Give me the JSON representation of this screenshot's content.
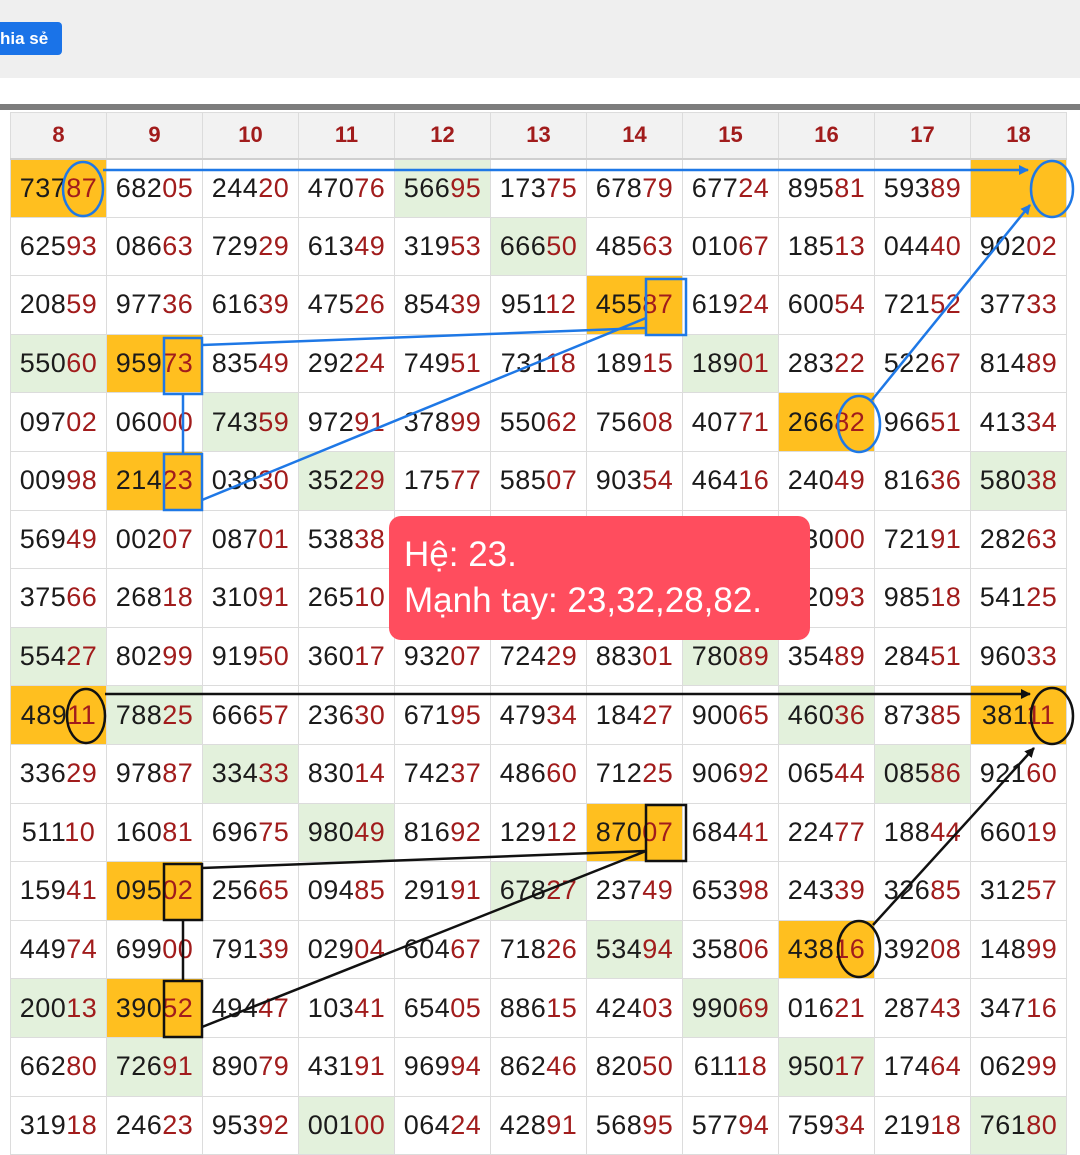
{
  "header": {
    "share_label": "hia sẻ"
  },
  "columns": [
    "8",
    "9",
    "10",
    "11",
    "12",
    "13",
    "14",
    "15",
    "16",
    "17",
    "18"
  ],
  "rows": [
    [
      {
        "h": "737",
        "t": "87",
        "s": "o"
      },
      {
        "h": "682",
        "t": "05"
      },
      {
        "h": "244",
        "t": "20"
      },
      {
        "h": "470",
        "t": "76"
      },
      {
        "h": "566",
        "t": "95",
        "s": "g"
      },
      {
        "h": "173",
        "t": "75"
      },
      {
        "h": "678",
        "t": "79"
      },
      {
        "h": "677",
        "t": "24"
      },
      {
        "h": "895",
        "t": "81"
      },
      {
        "h": "593",
        "t": "89"
      },
      {
        "h": "",
        "t": "",
        "s": "o"
      }
    ],
    [
      {
        "h": "625",
        "t": "93"
      },
      {
        "h": "086",
        "t": "63"
      },
      {
        "h": "729",
        "t": "29"
      },
      {
        "h": "613",
        "t": "49"
      },
      {
        "h": "319",
        "t": "53"
      },
      {
        "h": "666",
        "t": "50",
        "s": "g"
      },
      {
        "h": "485",
        "t": "63"
      },
      {
        "h": "010",
        "t": "67"
      },
      {
        "h": "185",
        "t": "13"
      },
      {
        "h": "044",
        "t": "40"
      },
      {
        "h": "902",
        "t": "02"
      }
    ],
    [
      {
        "h": "208",
        "t": "59"
      },
      {
        "h": "977",
        "t": "36"
      },
      {
        "h": "616",
        "t": "39"
      },
      {
        "h": "475",
        "t": "26"
      },
      {
        "h": "854",
        "t": "39"
      },
      {
        "h": "951",
        "t": "12"
      },
      {
        "h": "455",
        "t": "87",
        "s": "o"
      },
      {
        "h": "619",
        "t": "24"
      },
      {
        "h": "600",
        "t": "54"
      },
      {
        "h": "721",
        "t": "52"
      },
      {
        "h": "377",
        "t": "33"
      }
    ],
    [
      {
        "h": "550",
        "t": "60",
        "s": "g"
      },
      {
        "h": "959",
        "t": "73",
        "s": "o"
      },
      {
        "h": "835",
        "t": "49"
      },
      {
        "h": "292",
        "t": "24"
      },
      {
        "h": "749",
        "t": "51"
      },
      {
        "h": "731",
        "t": "18"
      },
      {
        "h": "189",
        "t": "15"
      },
      {
        "h": "189",
        "t": "01",
        "s": "g"
      },
      {
        "h": "283",
        "t": "22"
      },
      {
        "h": "522",
        "t": "67"
      },
      {
        "h": "814",
        "t": "89"
      }
    ],
    [
      {
        "h": "097",
        "t": "02"
      },
      {
        "h": "060",
        "t": "00"
      },
      {
        "h": "743",
        "t": "59",
        "s": "g"
      },
      {
        "h": "972",
        "t": "91"
      },
      {
        "h": "378",
        "t": "99"
      },
      {
        "h": "550",
        "t": "62"
      },
      {
        "h": "756",
        "t": "08"
      },
      {
        "h": "407",
        "t": "71"
      },
      {
        "h": "266",
        "t": "82",
        "s": "o"
      },
      {
        "h": "966",
        "t": "51"
      },
      {
        "h": "413",
        "t": "34"
      }
    ],
    [
      {
        "h": "009",
        "t": "98"
      },
      {
        "h": "214",
        "t": "23",
        "s": "o"
      },
      {
        "h": "038",
        "t": "30"
      },
      {
        "h": "352",
        "t": "29",
        "s": "g"
      },
      {
        "h": "175",
        "t": "77"
      },
      {
        "h": "585",
        "t": "07"
      },
      {
        "h": "903",
        "t": "54"
      },
      {
        "h": "464",
        "t": "16"
      },
      {
        "h": "240",
        "t": "49"
      },
      {
        "h": "816",
        "t": "36"
      },
      {
        "h": "580",
        "t": "38",
        "s": "g"
      }
    ],
    [
      {
        "h": "569",
        "t": "49"
      },
      {
        "h": "002",
        "t": "07"
      },
      {
        "h": "087",
        "t": "01"
      },
      {
        "h": "538",
        "t": "38"
      },
      {
        "h": "",
        "t": ""
      },
      {
        "h": "",
        "t": ""
      },
      {
        "h": "",
        "t": ""
      },
      {
        "h": "",
        "t": ""
      },
      {
        "h": "130",
        "t": "00"
      },
      {
        "h": "721",
        "t": "91"
      },
      {
        "h": "282",
        "t": "63"
      }
    ],
    [
      {
        "h": "375",
        "t": "66"
      },
      {
        "h": "268",
        "t": "18"
      },
      {
        "h": "310",
        "t": "91"
      },
      {
        "h": "265",
        "t": "10"
      },
      {
        "h": "",
        "t": ""
      },
      {
        "h": "",
        "t": ""
      },
      {
        "h": "",
        "t": ""
      },
      {
        "h": "",
        "t": ""
      },
      {
        "h": "120",
        "t": "93"
      },
      {
        "h": "985",
        "t": "18"
      },
      {
        "h": "541",
        "t": "25"
      }
    ],
    [
      {
        "h": "554",
        "t": "27",
        "s": "g"
      },
      {
        "h": "802",
        "t": "99"
      },
      {
        "h": "919",
        "t": "50"
      },
      {
        "h": "360",
        "t": "17"
      },
      {
        "h": "932",
        "t": "07"
      },
      {
        "h": "724",
        "t": "29"
      },
      {
        "h": "883",
        "t": "01"
      },
      {
        "h": "780",
        "t": "89",
        "s": "g"
      },
      {
        "h": "354",
        "t": "89"
      },
      {
        "h": "284",
        "t": "51"
      },
      {
        "h": "960",
        "t": "33"
      }
    ],
    [
      {
        "h": "489",
        "t": "11",
        "s": "o"
      },
      {
        "h": "788",
        "t": "25",
        "s": "g"
      },
      {
        "h": "666",
        "t": "57"
      },
      {
        "h": "236",
        "t": "30"
      },
      {
        "h": "671",
        "t": "95"
      },
      {
        "h": "479",
        "t": "34"
      },
      {
        "h": "184",
        "t": "27"
      },
      {
        "h": "900",
        "t": "65"
      },
      {
        "h": "460",
        "t": "36",
        "s": "g"
      },
      {
        "h": "873",
        "t": "85"
      },
      {
        "h": "381",
        "t": "11",
        "s": "o"
      }
    ],
    [
      {
        "h": "336",
        "t": "29"
      },
      {
        "h": "978",
        "t": "87"
      },
      {
        "h": "334",
        "t": "33",
        "s": "g"
      },
      {
        "h": "830",
        "t": "14"
      },
      {
        "h": "742",
        "t": "37"
      },
      {
        "h": "486",
        "t": "60"
      },
      {
        "h": "712",
        "t": "25"
      },
      {
        "h": "906",
        "t": "92"
      },
      {
        "h": "065",
        "t": "44"
      },
      {
        "h": "085",
        "t": "86",
        "s": "g"
      },
      {
        "h": "921",
        "t": "60"
      }
    ],
    [
      {
        "h": "511",
        "t": "10"
      },
      {
        "h": "160",
        "t": "81"
      },
      {
        "h": "696",
        "t": "75"
      },
      {
        "h": "980",
        "t": "49",
        "s": "g"
      },
      {
        "h": "816",
        "t": "92"
      },
      {
        "h": "129",
        "t": "12"
      },
      {
        "h": "870",
        "t": "07",
        "s": "o"
      },
      {
        "h": "684",
        "t": "41"
      },
      {
        "h": "224",
        "t": "77"
      },
      {
        "h": "188",
        "t": "44"
      },
      {
        "h": "660",
        "t": "19"
      }
    ],
    [
      {
        "h": "159",
        "t": "41"
      },
      {
        "h": "095",
        "t": "02",
        "s": "o"
      },
      {
        "h": "256",
        "t": "65"
      },
      {
        "h": "094",
        "t": "85"
      },
      {
        "h": "291",
        "t": "91"
      },
      {
        "h": "678",
        "t": "27",
        "s": "g"
      },
      {
        "h": "237",
        "t": "49"
      },
      {
        "h": "653",
        "t": "98"
      },
      {
        "h": "243",
        "t": "39"
      },
      {
        "h": "326",
        "t": "85"
      },
      {
        "h": "312",
        "t": "57"
      }
    ],
    [
      {
        "h": "449",
        "t": "74"
      },
      {
        "h": "699",
        "t": "00"
      },
      {
        "h": "791",
        "t": "39"
      },
      {
        "h": "029",
        "t": "04"
      },
      {
        "h": "604",
        "t": "67"
      },
      {
        "h": "718",
        "t": "26"
      },
      {
        "h": "534",
        "t": "94",
        "s": "g"
      },
      {
        "h": "358",
        "t": "06"
      },
      {
        "h": "438",
        "t": "16",
        "s": "o"
      },
      {
        "h": "392",
        "t": "08"
      },
      {
        "h": "148",
        "t": "99"
      }
    ],
    [
      {
        "h": "200",
        "t": "13",
        "s": "g"
      },
      {
        "h": "390",
        "t": "52",
        "s": "o"
      },
      {
        "h": "494",
        "t": "47"
      },
      {
        "h": "103",
        "t": "41"
      },
      {
        "h": "654",
        "t": "05"
      },
      {
        "h": "886",
        "t": "15"
      },
      {
        "h": "424",
        "t": "03"
      },
      {
        "h": "990",
        "t": "69",
        "s": "g"
      },
      {
        "h": "016",
        "t": "21"
      },
      {
        "h": "287",
        "t": "43"
      },
      {
        "h": "347",
        "t": "16"
      }
    ],
    [
      {
        "h": "662",
        "t": "80"
      },
      {
        "h": "726",
        "t": "91",
        "s": "g"
      },
      {
        "h": "890",
        "t": "79"
      },
      {
        "h": "431",
        "t": "91"
      },
      {
        "h": "969",
        "t": "94"
      },
      {
        "h": "862",
        "t": "46"
      },
      {
        "h": "820",
        "t": "50"
      },
      {
        "h": "611",
        "t": "18"
      },
      {
        "h": "950",
        "t": "17",
        "s": "g"
      },
      {
        "h": "174",
        "t": "64"
      },
      {
        "h": "062",
        "t": "99"
      }
    ],
    [
      {
        "h": "319",
        "t": "18"
      },
      {
        "h": "246",
        "t": "23"
      },
      {
        "h": "953",
        "t": "92"
      },
      {
        "h": "001",
        "t": "00",
        "s": "g"
      },
      {
        "h": "064",
        "t": "24"
      },
      {
        "h": "428",
        "t": "91"
      },
      {
        "h": "568",
        "t": "95"
      },
      {
        "h": "577",
        "t": "94"
      },
      {
        "h": "759",
        "t": "34"
      },
      {
        "h": "219",
        "t": "18"
      },
      {
        "h": "761",
        "t": "80",
        "s": "g"
      }
    ]
  ],
  "callout": {
    "line1": "Hệ: 23.",
    "line2": "Mạnh tay: 23,32,28,82."
  },
  "colors": {
    "highlight": "#ffbf1f",
    "soft_green": "#e3f1dc",
    "blue_marks": "#1e78e6",
    "callout_bg": "#ff4d5e",
    "number_tail": "#a11c1c"
  }
}
